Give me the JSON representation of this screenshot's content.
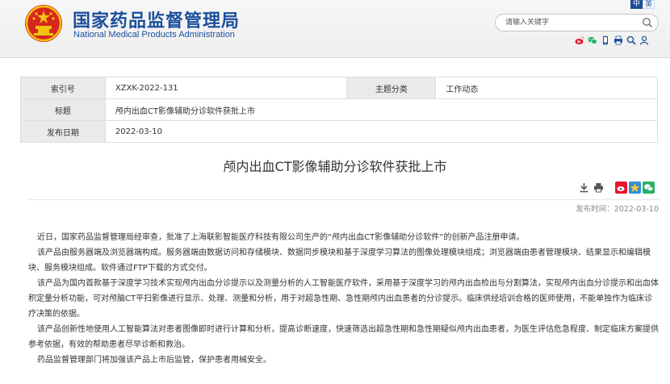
{
  "header": {
    "site_name_cn": "国家药品监督管理局",
    "site_name_en": "National Medical Products Administration",
    "lang": {
      "active": "中",
      "inactive": "英"
    },
    "search_placeholder": "请输入关键字"
  },
  "meta": {
    "index_label": "索引号",
    "index_value": "XZXK-2022-131",
    "category_label": "主题分类",
    "category_value": "工作动态",
    "title_label": "标题",
    "title_value": "颅内出血CT影像辅助分诊软件获批上市",
    "date_label": "发布日期",
    "date_value": "2022-03-10"
  },
  "article": {
    "title": "颅内出血CT影像辅助分诊软件获批上市",
    "publish_time": "发布时间：2022-03-10",
    "paragraphs": [
      "近日，国家药品监督管理局经审查，批准了上海联影智能医疗科技有限公司生产的“颅内出血CT影像辅助分诊软件”的创新产品注册申请。",
      "该产品由服务器端及浏览器端构成。服务器端由数据访问和存储模块、数据同步模块和基于深度学习算法的图像处理模块组成；浏览器端由患者管理模块、结果显示和编辑模块、服务模块组成。软件通过FTP下载的方式交付。",
      "该产品为国内首款基于深度学习技术实现颅内出血分诊提示以及测量分析的人工智能医疗软件，采用基于深度学习的颅内出血检出与分割算法，实现颅内出血分诊提示和出血体积定量分析功能，可对颅脑CT平扫影像进行显示、处理、测量和分析，用于对超急性期、急性期颅内出血患者的分诊提示。临床供经培训合格的医师使用，不能单独作为临床诊疗决策的依据。",
      "该产品创新性地使用人工智能算法对患者图像即时进行计算和分析，提高诊断速度，快速筛选出超急性期和急性期疑似颅内出血患者，为医生评估危急程度、制定临床方案提供参考依据，有效的帮助患者尽早诊断和救治。",
      "药品监督管理部门将加强该产品上市后监管，保护患者用械安全。"
    ]
  },
  "icons": {
    "header_social": [
      "weibo-icon",
      "wechat-icon",
      "mobile-icon",
      "print-icon",
      "search-icon",
      "user-icon"
    ],
    "tools": [
      "download-icon",
      "print-icon"
    ],
    "share": [
      "weibo-share-icon",
      "qzone-share-icon",
      "wechat-share-icon"
    ]
  },
  "colors": {
    "brand_blue": "#1b4f9c",
    "emblem_red": "#d7261e",
    "emblem_gold": "#f2c30f",
    "weibo_red": "#e6162d",
    "wechat_green": "#2aae67",
    "qzone_blue": "#2f8fd8"
  }
}
